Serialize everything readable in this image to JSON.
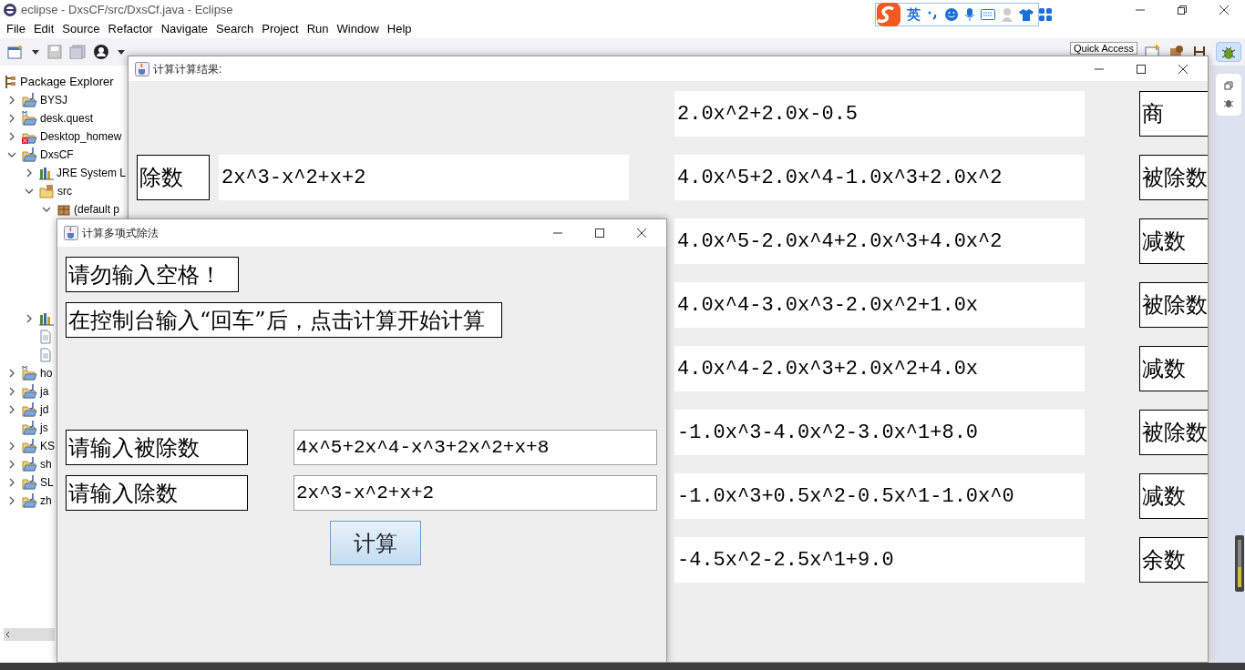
{
  "eclipse": {
    "title": "eclipse - DxsCF/src/DxsCf.java - Eclipse",
    "menu": [
      "File",
      "Edit",
      "Source",
      "Refactor",
      "Navigate",
      "Search",
      "Project",
      "Run",
      "Window",
      "Help"
    ],
    "quick_access": "Quick Access"
  },
  "ime_bar": {
    "mode": "英"
  },
  "package_explorer": {
    "title": "Package Explorer",
    "items": [
      {
        "label": "BYSJ",
        "kind": "project",
        "expandable": true,
        "expanded": false
      },
      {
        "label": "desk.quest",
        "kind": "maven",
        "expandable": true,
        "expanded": false
      },
      {
        "label": "Desktop_homew",
        "kind": "error",
        "expandable": true,
        "expanded": false
      },
      {
        "label": "DxsCF",
        "kind": "project",
        "expandable": true,
        "expanded": true,
        "children": [
          {
            "label": "JRE System L",
            "kind": "library",
            "expandable": true,
            "expanded": false
          },
          {
            "label": "src",
            "kind": "source",
            "expandable": true,
            "expanded": true,
            "children": [
              {
                "label": "(default p",
                "kind": "package",
                "expandable": true,
                "expanded": true
              }
            ]
          },
          {
            "kind": "library",
            "expandable": true,
            "expanded": false
          },
          {
            "kind": "file",
            "expandable": false
          },
          {
            "kind": "file",
            "expandable": false
          }
        ]
      },
      {
        "label": "ho",
        "kind": "maven",
        "expandable": true,
        "expanded": false
      },
      {
        "label": "ja",
        "kind": "project",
        "expandable": true,
        "expanded": false
      },
      {
        "label": "jd",
        "kind": "project",
        "expandable": true,
        "expanded": false
      },
      {
        "label": "js",
        "kind": "project",
        "expandable": false
      },
      {
        "label": "KS",
        "kind": "project",
        "expandable": true,
        "expanded": false
      },
      {
        "label": "sh",
        "kind": "project",
        "expandable": true,
        "expanded": false
      },
      {
        "label": "SL",
        "kind": "project",
        "expandable": true,
        "expanded": false
      },
      {
        "label": "zh",
        "kind": "project",
        "expandable": true,
        "expanded": false
      }
    ]
  },
  "result_window": {
    "title": "计算计算结果:",
    "divisor": {
      "label": "除数",
      "value": "2x^3-x^2+x+2"
    },
    "rows": [
      {
        "value": "2.0x^2+2.0x-0.5",
        "label": "商"
      },
      {
        "value": "4.0x^5+2.0x^4-1.0x^3+2.0x^2",
        "label": "被除数"
      },
      {
        "value": "4.0x^5-2.0x^4+2.0x^3+4.0x^2",
        "label": "减数"
      },
      {
        "value": "4.0x^4-3.0x^3-2.0x^2+1.0x",
        "label": "被除数"
      },
      {
        "value": "4.0x^4-2.0x^3+2.0x^2+4.0x",
        "label": "减数"
      },
      {
        "value": "-1.0x^3-4.0x^2-3.0x^1+8.0",
        "label": "被除数"
      },
      {
        "value": "-1.0x^3+0.5x^2-0.5x^1-1.0x^0",
        "label": "减数"
      },
      {
        "value": "-4.5x^2-2.5x^1+9.0",
        "label": "余数"
      }
    ]
  },
  "dialog": {
    "title": "计算多项式除法",
    "notices": [
      "请勿输入空格！",
      "在控制台输入“回车”后，点击计算开始计算"
    ],
    "fields": [
      {
        "label": "请输入被除数",
        "value": "4x^5+2x^4-x^3+2x^2+x+8"
      },
      {
        "label": "请输入除数",
        "value": "2x^3-x^2+x+2"
      }
    ],
    "button": "计算"
  }
}
